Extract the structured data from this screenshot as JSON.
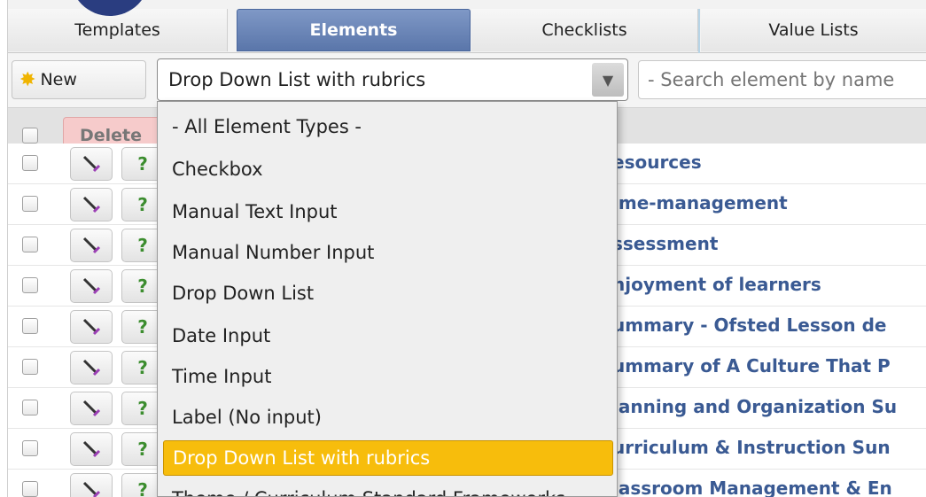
{
  "tabs": [
    {
      "label": "Templates",
      "active": false
    },
    {
      "label": "Elements",
      "active": true
    },
    {
      "label": "Checklists",
      "active": false
    },
    {
      "label": "Value Lists",
      "active": false
    }
  ],
  "toolbar": {
    "new_label": "New",
    "type_select_value": "Drop Down List with rubrics",
    "search_placeholder": "- Search element by name"
  },
  "header": {
    "delete_label": "Delete"
  },
  "dropdown": {
    "options": [
      "- All Element Types -",
      "Checkbox",
      "Manual Text Input",
      "Manual Number Input",
      "Drop Down List",
      "Date Input",
      "Time Input",
      "Label (No input)",
      "Drop Down List with rubrics",
      "Theme / Curriculum Standard Frameworks"
    ],
    "selected": "Drop Down List with rubrics"
  },
  "rows": [
    {
      "label": "esources"
    },
    {
      "label": "ime-management"
    },
    {
      "label": "ssessment"
    },
    {
      "label": "njoyment of learners"
    },
    {
      "label": "ummary - Ofsted Lesson de"
    },
    {
      "label": "ummary of A Culture That P"
    },
    {
      "label": "lanning and Organization Su"
    },
    {
      "label": "urriculum & Instruction Sun"
    },
    {
      "label": "lassroom Management & En"
    }
  ],
  "colors": {
    "accent_tab": "#5a76aa",
    "selected_option": "#f7bd0c",
    "row_link": "#3a5a93",
    "delete_bg": "#f6cbcb"
  },
  "icons": {
    "new": "star-icon",
    "select_arrow": "triangle-down-icon",
    "edit": "pencil-icon",
    "help": "question-icon"
  }
}
